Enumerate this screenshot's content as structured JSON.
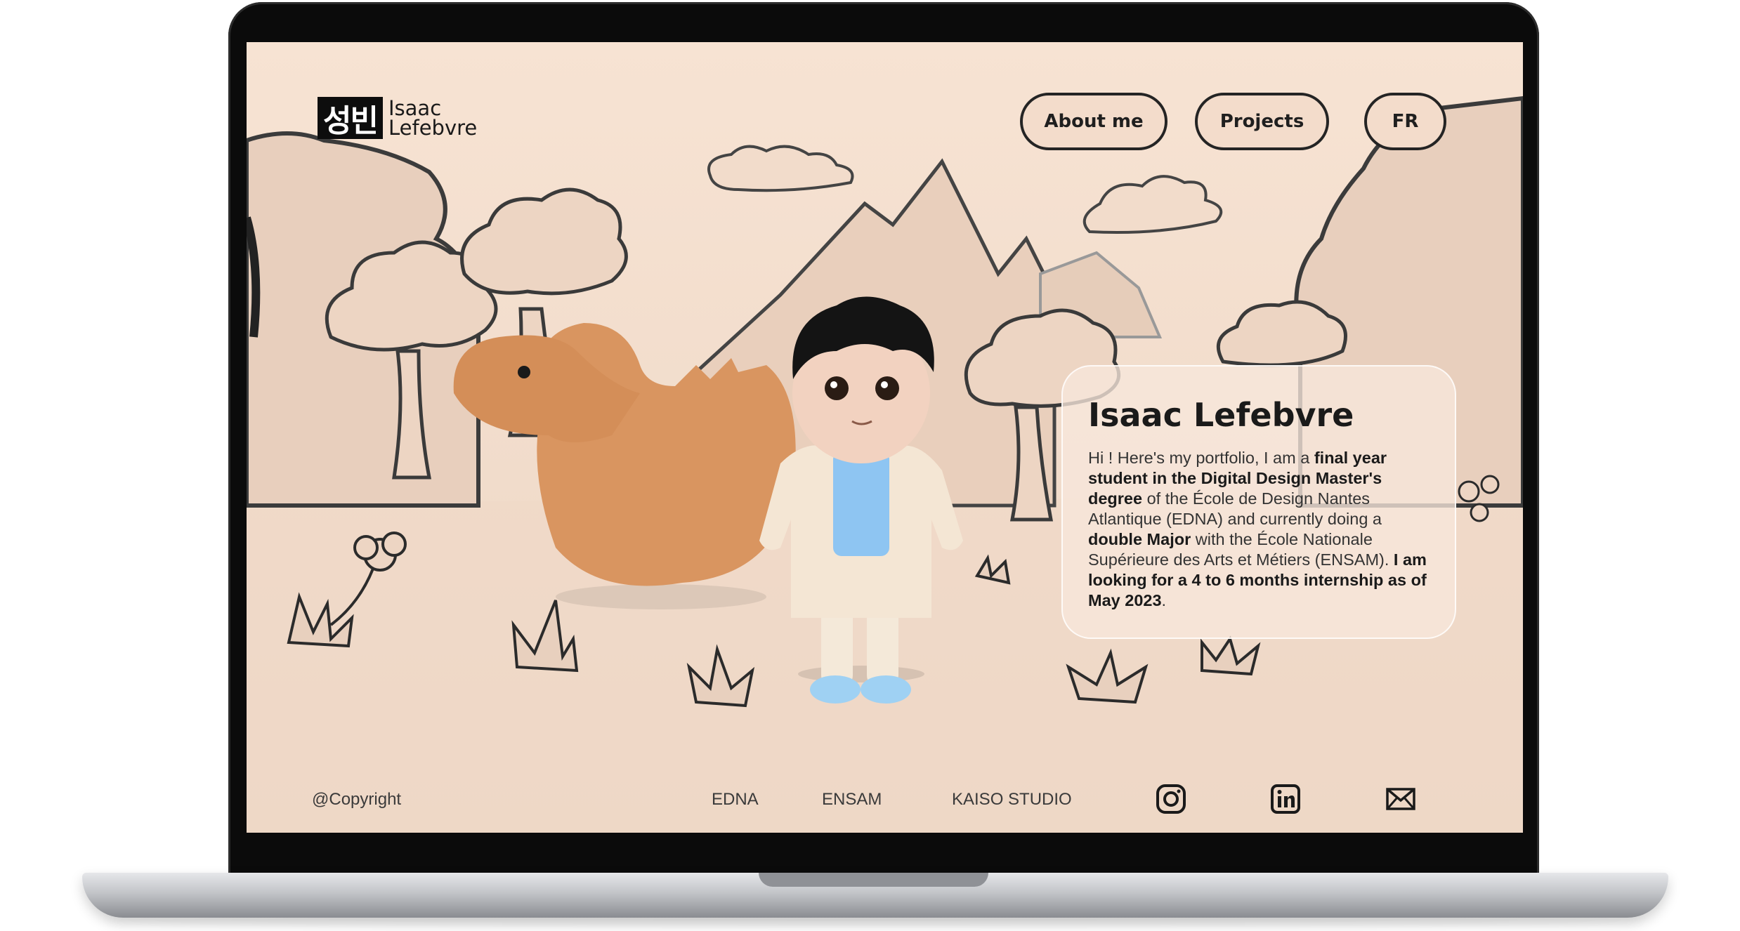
{
  "logo": {
    "mark": "성빈",
    "name_line1": "Isaac",
    "name_line2": "Lefebvre"
  },
  "nav": {
    "about": "About me",
    "projects": "Projects",
    "lang": "FR"
  },
  "card": {
    "title": "Isaac Lefebvre",
    "text": [
      {
        "t": "Hi ! Here's my portfolio, I am a ",
        "b": false
      },
      {
        "t": "final year student in the Digital Design Master's degree",
        "b": true
      },
      {
        "t": " of the École de Design Nantes Atlantique (EDNA) and currently doing a ",
        "b": false
      },
      {
        "t": "double Major",
        "b": true
      },
      {
        "t": " with the École Nationale Supérieure des Arts et Métiers (ENSAM). ",
        "b": false
      },
      {
        "t": "I am looking for a 4 to 6 months internship as of May 2023",
        "b": true
      },
      {
        "t": ".",
        "b": false
      }
    ]
  },
  "footer": {
    "copyright": "@Copyright",
    "links": [
      "EDNA",
      "ENSAM",
      "KAISO STUDIO"
    ],
    "social": [
      "instagram-icon",
      "linkedin-icon",
      "mail-icon"
    ]
  },
  "colors": {
    "background": "#f3dfcf",
    "ink": "#242424",
    "dino": "#d99560",
    "shirt": "#8ec5f2"
  }
}
